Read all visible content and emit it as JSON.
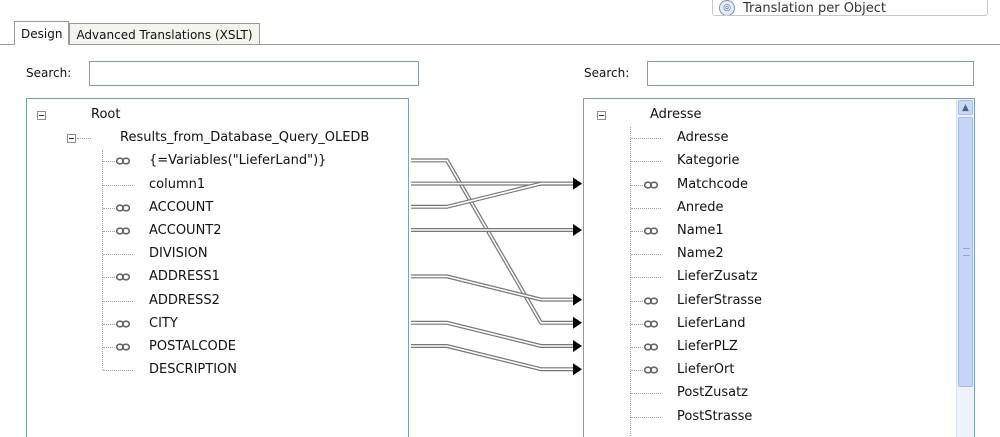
{
  "top_option": {
    "label": "Translation per Object"
  },
  "tabs": [
    {
      "label": "Design",
      "active": true
    },
    {
      "label": "Advanced Translations (XSLT)",
      "active": false
    }
  ],
  "left": {
    "search_label": "Search:",
    "search_value": "",
    "root": "Root",
    "query_node": "Results_from_Database_Query_OLEDB",
    "fields": [
      {
        "label": "{=Variables(\"LieferLand\")}",
        "linked": true
      },
      {
        "label": "column1",
        "linked": false
      },
      {
        "label": "ACCOUNT",
        "linked": true
      },
      {
        "label": "ACCOUNT2",
        "linked": true
      },
      {
        "label": "DIVISION",
        "linked": false
      },
      {
        "label": "ADDRESS1",
        "linked": true
      },
      {
        "label": "ADDRESS2",
        "linked": false
      },
      {
        "label": "CITY",
        "linked": true
      },
      {
        "label": "POSTALCODE",
        "linked": true
      },
      {
        "label": "DESCRIPTION",
        "linked": false
      }
    ]
  },
  "right": {
    "search_label": "Search:",
    "search_value": "",
    "root": "Adresse",
    "fields": [
      {
        "label": "Adresse",
        "linked": false
      },
      {
        "label": "Kategorie",
        "linked": false
      },
      {
        "label": "Matchcode",
        "linked": true
      },
      {
        "label": "Anrede",
        "linked": false
      },
      {
        "label": "Name1",
        "linked": true
      },
      {
        "label": "Name2",
        "linked": false
      },
      {
        "label": "LieferZusatz",
        "linked": false
      },
      {
        "label": "LieferStrasse",
        "linked": true
      },
      {
        "label": "LieferLand",
        "linked": true
      },
      {
        "label": "LieferPLZ",
        "linked": true
      },
      {
        "label": "LieferOrt",
        "linked": true
      },
      {
        "label": "PostZusatz",
        "linked": false
      },
      {
        "label": "PostStrasse",
        "linked": false
      }
    ]
  },
  "mappings": [
    {
      "from": 0,
      "to": 8
    },
    {
      "from": 1,
      "to": 2
    },
    {
      "from": 2,
      "to": 2
    },
    {
      "from": 3,
      "to": 4
    },
    {
      "from": 5,
      "to": 7
    },
    {
      "from": 7,
      "to": 9
    },
    {
      "from": 8,
      "to": 10
    }
  ],
  "colors": {
    "panel_border": "#7f9db9",
    "connector": "#777777",
    "arrow": "#000000"
  }
}
